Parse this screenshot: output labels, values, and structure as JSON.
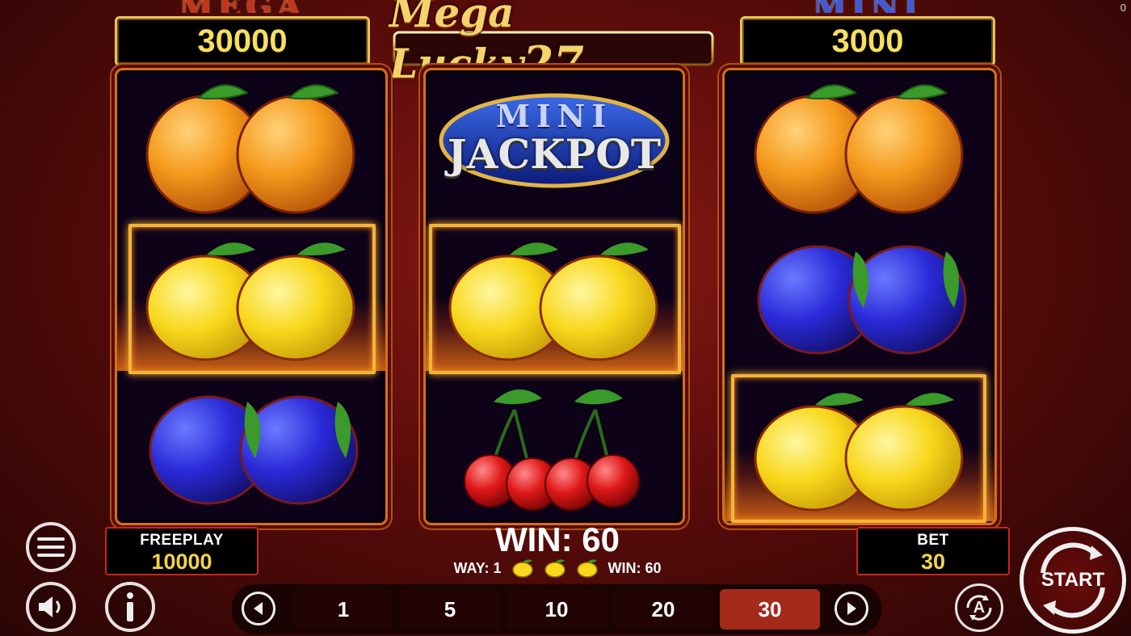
{
  "corner_value": "0",
  "logo": {
    "text_main": "Mega Lucky",
    "text_num": "27"
  },
  "jackpots": {
    "mega": {
      "label": "MEGA",
      "value": "30000"
    },
    "mini": {
      "label": "MINI",
      "value": "3000"
    }
  },
  "reels": [
    {
      "symbols": [
        "orange",
        "lemon",
        "plum"
      ]
    },
    {
      "symbols": [
        "mini-jackpot",
        "lemon",
        "cherry"
      ]
    },
    {
      "symbols": [
        "orange",
        "plum",
        "lemon"
      ]
    }
  ],
  "mini_jackpot_symbol": {
    "top": "MINI",
    "bottom": "JACKPOT"
  },
  "freeplay": {
    "label": "FREEPLAY",
    "value": "10000"
  },
  "bet": {
    "label": "BET",
    "value": "30"
  },
  "win": {
    "main": "WIN: 60",
    "way_label": "WAY: 1",
    "line_win": "WIN: 60",
    "line_symbols": [
      "lemon",
      "lemon",
      "lemon"
    ]
  },
  "bet_options": [
    "1",
    "5",
    "10",
    "20",
    "30"
  ],
  "selected_bet": "30",
  "start_label": "START",
  "autoplay_letter": "A",
  "colors": {
    "background": "#6a0f0c",
    "gold": "#f3d34e",
    "active_bet": "#a42a1a",
    "frame": "#f2b53a"
  },
  "icons": [
    "menu-icon",
    "sound-icon",
    "info-icon",
    "prev-arrow-icon",
    "next-arrow-icon",
    "autoplay-icon",
    "start-spin-icon"
  ]
}
